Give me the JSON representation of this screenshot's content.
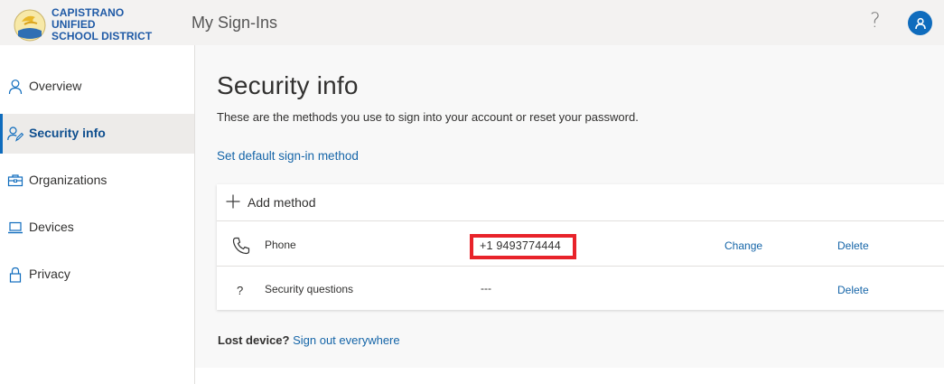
{
  "header": {
    "org_name_line1": "CAPISTRANO UNIFIED",
    "org_name_line2": "SCHOOL DISTRICT",
    "app_title": "My Sign-Ins",
    "help_label": "?"
  },
  "sidebar": {
    "items": [
      {
        "label": "Overview",
        "icon": "person-icon",
        "active": false
      },
      {
        "label": "Security info",
        "icon": "security-info-icon",
        "active": true
      },
      {
        "label": "Organizations",
        "icon": "briefcase-icon",
        "active": false
      },
      {
        "label": "Devices",
        "icon": "laptop-icon",
        "active": false
      },
      {
        "label": "Privacy",
        "icon": "lock-icon",
        "active": false
      }
    ]
  },
  "main": {
    "title": "Security info",
    "description": "These are the methods you use to sign into your account or reset your password.",
    "default_link": "Set default sign-in method",
    "add_method": "Add method",
    "methods": [
      {
        "name": "Phone",
        "value": "+1 9493774444",
        "change": "Change",
        "delete": "Delete",
        "icon": "phone-icon"
      },
      {
        "name": "Security questions",
        "value": "---",
        "delete": "Delete",
        "icon": "question-icon",
        "icon_glyph": "?"
      }
    ],
    "lost_device_label": "Lost device?",
    "sign_out_link": "Sign out everywhere"
  },
  "colors": {
    "accent": "#0f6cbd",
    "link": "#1565a8",
    "highlight_box": "#e8232a",
    "topbar_bg": "#f3f2f1"
  }
}
